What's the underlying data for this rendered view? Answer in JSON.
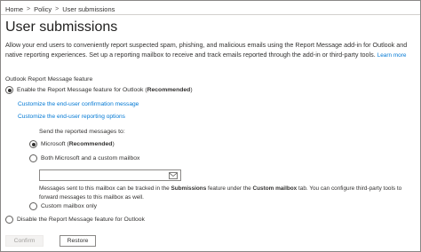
{
  "breadcrumb": {
    "items": [
      "Home",
      "Policy",
      "User submissions"
    ],
    "separator": ">"
  },
  "page": {
    "title": "User submissions",
    "description": "Allow your end users to conveniently report suspected spam, phishing, and malicious emails using the Report Message add-in for Outlook and native reporting experiences. Set up a reporting mailbox to receive and track emails reported through the add-in or third-party tools.",
    "learn_more": "Learn more"
  },
  "outlook_section": {
    "label": "Outlook Report Message feature",
    "enable_option": {
      "text": "Enable the Report Message feature for Outlook (",
      "bold": "Recommended",
      "suffix": ")",
      "checked": true
    },
    "links": {
      "confirmation": "Customize the end-user confirmation message",
      "reporting_options": "Customize the end-user reporting options"
    },
    "send_label": "Send the reported messages to:",
    "send_options": {
      "microsoft": {
        "text": "Microsoft (",
        "bold": "Recommended",
        "suffix": ")",
        "checked": true
      },
      "both": {
        "text": "Both Microsoft and a custom mailbox",
        "checked": false
      },
      "custom": {
        "text": "Custom mailbox only",
        "checked": false
      }
    },
    "mailbox_input": {
      "value": "",
      "placeholder": "",
      "icon": "mail-icon"
    },
    "note": {
      "part1": "Messages sent to this mailbox can be tracked in the ",
      "bold1": "Submissions",
      "part2": " feature under the ",
      "bold2": "Custom mailbox",
      "part3": " tab. You can configure third-party tools to forward messages to this mailbox as well."
    },
    "disable_option": {
      "text": "Disable the Report Message feature for Outlook",
      "checked": false
    }
  },
  "buttons": {
    "confirm": "Confirm",
    "restore": "Restore"
  }
}
